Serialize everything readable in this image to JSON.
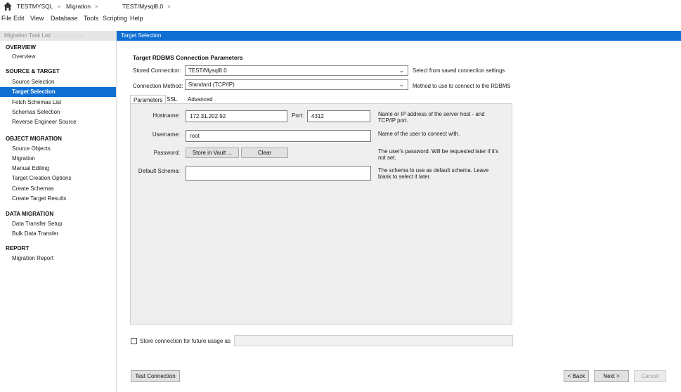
{
  "tabs": [
    {
      "label": "TESTMYSQL",
      "close": "×"
    },
    {
      "label": "Migration",
      "close": "×"
    },
    {
      "label": "TEST/Mysql8.0",
      "close": "×"
    }
  ],
  "menu": [
    "File",
    "Edit",
    "View",
    "Database",
    "Tools",
    "Scripting",
    "Help"
  ],
  "sidebar": {
    "header": "Migration Task List",
    "sections": [
      {
        "title": "OVERVIEW",
        "items": [
          "Overview"
        ]
      },
      {
        "title": "SOURCE & TARGET",
        "items": [
          "Source Selection",
          "Target Selection",
          "Fetch Schemas List",
          "Schemas Selection",
          "Reverse Engineer Source"
        ]
      },
      {
        "title": "OBJECT MIGRATION",
        "items": [
          "Source Objects",
          "Migration",
          "Manual Editing",
          "Target Creation Options",
          "Create Schemas",
          "Create Target Results"
        ]
      },
      {
        "title": "DATA MIGRATION",
        "items": [
          "Data Transfer Setup",
          "Bulk Data Transfer"
        ]
      },
      {
        "title": "REPORT",
        "items": [
          "Migration Report"
        ]
      }
    ],
    "selected": "Target Selection"
  },
  "main": {
    "header": "Target Selection",
    "title": "Target RDBMS Connection Parameters",
    "stored_connection": {
      "label": "Stored Connection:",
      "value": "TEST/Mysql8.0",
      "hint": "Select from saved connection settings"
    },
    "connection_method": {
      "label": "Connection Method:",
      "value": "Standard (TCP/IP)",
      "hint": "Method to use to connect to the RDBMS"
    },
    "subtabs": [
      "Parameters",
      "SSL",
      "Advanced"
    ],
    "hostname": {
      "label": "Hostname:",
      "value": "172.31.202.92",
      "hint1": "Name or IP address of the server host - and",
      "hint2": "TCP/IP port."
    },
    "port": {
      "label": "Port:",
      "value": "4312"
    },
    "username": {
      "label": "Username:",
      "value": "root",
      "hint": "Name of the user to connect with."
    },
    "password": {
      "label": "Password:",
      "store_btn": "Store in Vault ...",
      "clear_btn": "Clear",
      "hint1": "The user's password. Will be requested later if it's",
      "hint2": "not set."
    },
    "default_schema": {
      "label": "Default Schema:",
      "value": "",
      "hint1": "The schema to use as default schema. Leave",
      "hint2": "blank to select it later."
    },
    "store_connection_label": "Store connection for future usage as",
    "test_connection": "Test Connection",
    "back": "< Back",
    "next": "Next >",
    "cancel": "Cancel"
  },
  "colors": {
    "accent": "#0f6fd3",
    "panel": "#efefef"
  }
}
